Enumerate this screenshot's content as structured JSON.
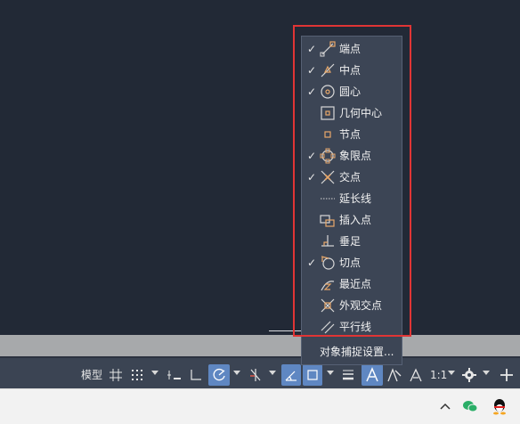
{
  "osnap_menu": {
    "items": [
      {
        "label": "端点",
        "checked": true,
        "icon": "endpoint-icon"
      },
      {
        "label": "中点",
        "checked": true,
        "icon": "midpoint-icon"
      },
      {
        "label": "圆心",
        "checked": true,
        "icon": "center-icon"
      },
      {
        "label": "几何中心",
        "checked": false,
        "icon": "geometric-center-icon"
      },
      {
        "label": "节点",
        "checked": false,
        "icon": "node-icon"
      },
      {
        "label": "象限点",
        "checked": true,
        "icon": "quadrant-icon"
      },
      {
        "label": "交点",
        "checked": true,
        "icon": "intersection-icon"
      },
      {
        "label": "延长线",
        "checked": false,
        "icon": "extension-icon"
      },
      {
        "label": "插入点",
        "checked": false,
        "icon": "insertion-icon"
      },
      {
        "label": "垂足",
        "checked": false,
        "icon": "perpendicular-icon"
      },
      {
        "label": "切点",
        "checked": true,
        "icon": "tangent-icon"
      },
      {
        "label": "最近点",
        "checked": false,
        "icon": "nearest-icon"
      },
      {
        "label": "外观交点",
        "checked": false,
        "icon": "apparent-intersection-icon"
      },
      {
        "label": "平行线",
        "checked": false,
        "icon": "parallel-icon"
      }
    ],
    "check_mark": "✓",
    "settings_label": "对象捕捉设置..."
  },
  "status_bar": {
    "model_label": "模型",
    "scale_label": "1:1"
  },
  "colors": {
    "canvas": "#222936",
    "menu_bg": "#3c4555",
    "icon_stroke": "#e8a86a",
    "active_button": "#5f87c2",
    "highlight": "#e03535"
  }
}
